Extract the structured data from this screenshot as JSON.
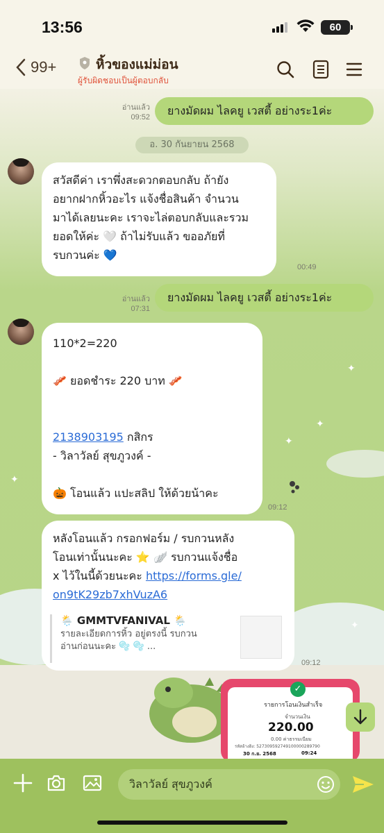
{
  "status_bar": {
    "time": "13:56",
    "battery": "60"
  },
  "header": {
    "back_count": "99+",
    "title": "หิ้วของแม่ม่อน",
    "subtitle": "ผู้รับผิดชอบเป็นผู้ตอบกลับ",
    "icons": [
      "chevron-left-icon",
      "shield-icon",
      "search-icon",
      "notes-icon",
      "menu-icon"
    ]
  },
  "chat": {
    "date_divider": "อ. 30 กันยายน 2568",
    "messages": [
      {
        "id": "m1",
        "side": "out",
        "text": "ยางมัดผม ไลคยู เวสตี้ อย่างระ1ค่ะ",
        "read": "อ่านแล้ว",
        "time": "09:52"
      },
      {
        "id": "m2",
        "side": "in",
        "text": "สวัสดีค่า เราพึ่งสะดวกตอบกลับ ถ้ายัง\nอยากฝากหิ้วอะไร แจ้งชื่อสินค้า จำนวน\nมาได้เลยนะคะ เราจะไล่ตอบกลับและรวม\nยอดให้ค่ะ 🤍 ถ้าไม่รับแล้ว ขออภัยที่\nรบกวนค่ะ 💙",
        "time": "00:49"
      },
      {
        "id": "m3",
        "side": "out",
        "text": "ยางมัดผม ไลคยู เวสตี้ อย่างระ1ค่ะ",
        "read": "อ่านแล้ว",
        "time": "07:31"
      },
      {
        "id": "m4",
        "side": "in",
        "line1": "110*2=220",
        "line2": "🥓 ยอดชำระ  220  บาท 🥓",
        "account_number": "2138903195",
        "bank": " กสิกร",
        "account_name": "- วิลาวัลย์ สุขภูวงค์ -",
        "line5": "🎃 โอนแล้ว แปะสลิป ให้ด้วยน้าคะ",
        "time": "09:12"
      },
      {
        "id": "m5",
        "side": "in",
        "text": "หลังโอนแล้ว กรอกฟอร์ม  / รบกวนหลัง\nโอนเท่านั้นนะคะ ⭐  🪽  รบกวนแจ้งชื่อ\nx ไว้ในนี้ด้วยนะคะ ",
        "link": "https://forms.gle/\non9tK29zb7xhVuzA6",
        "preview_title": "🌦️ GMMTVFANIVAL 🌦️",
        "preview_desc": "รายละเอียดการหิ้ว อยู่ตรงนี้ รบกวน\nอ่านก่อนนะคะ 🫧 🫧 ...",
        "time": "09:12"
      }
    ],
    "slip": {
      "title": "รายการโอนเงินสำเร็จ",
      "label": "จำนวนเงิน",
      "amount": "220.00",
      "fee": "0.00 ค่าธรรมเนียม",
      "ref": "รหัสอ้างอิง: 527309592749100000289790",
      "date": "30 ก.ย. 2568",
      "time": "09:24"
    }
  },
  "composer": {
    "input_value": "วิลาวัลย์ สุขภูวงค์",
    "icons": [
      "plus-icon",
      "camera-icon",
      "image-icon",
      "emoji-icon",
      "send-icon"
    ]
  },
  "colors": {
    "header_bg": "#f7f4e9",
    "outgoing_bubble": "#b4d77a",
    "incoming_bubble": "#ffffff",
    "composer_bg": "#9ec15e",
    "subtitle": "#e0533b",
    "link": "#2a6bd6"
  }
}
